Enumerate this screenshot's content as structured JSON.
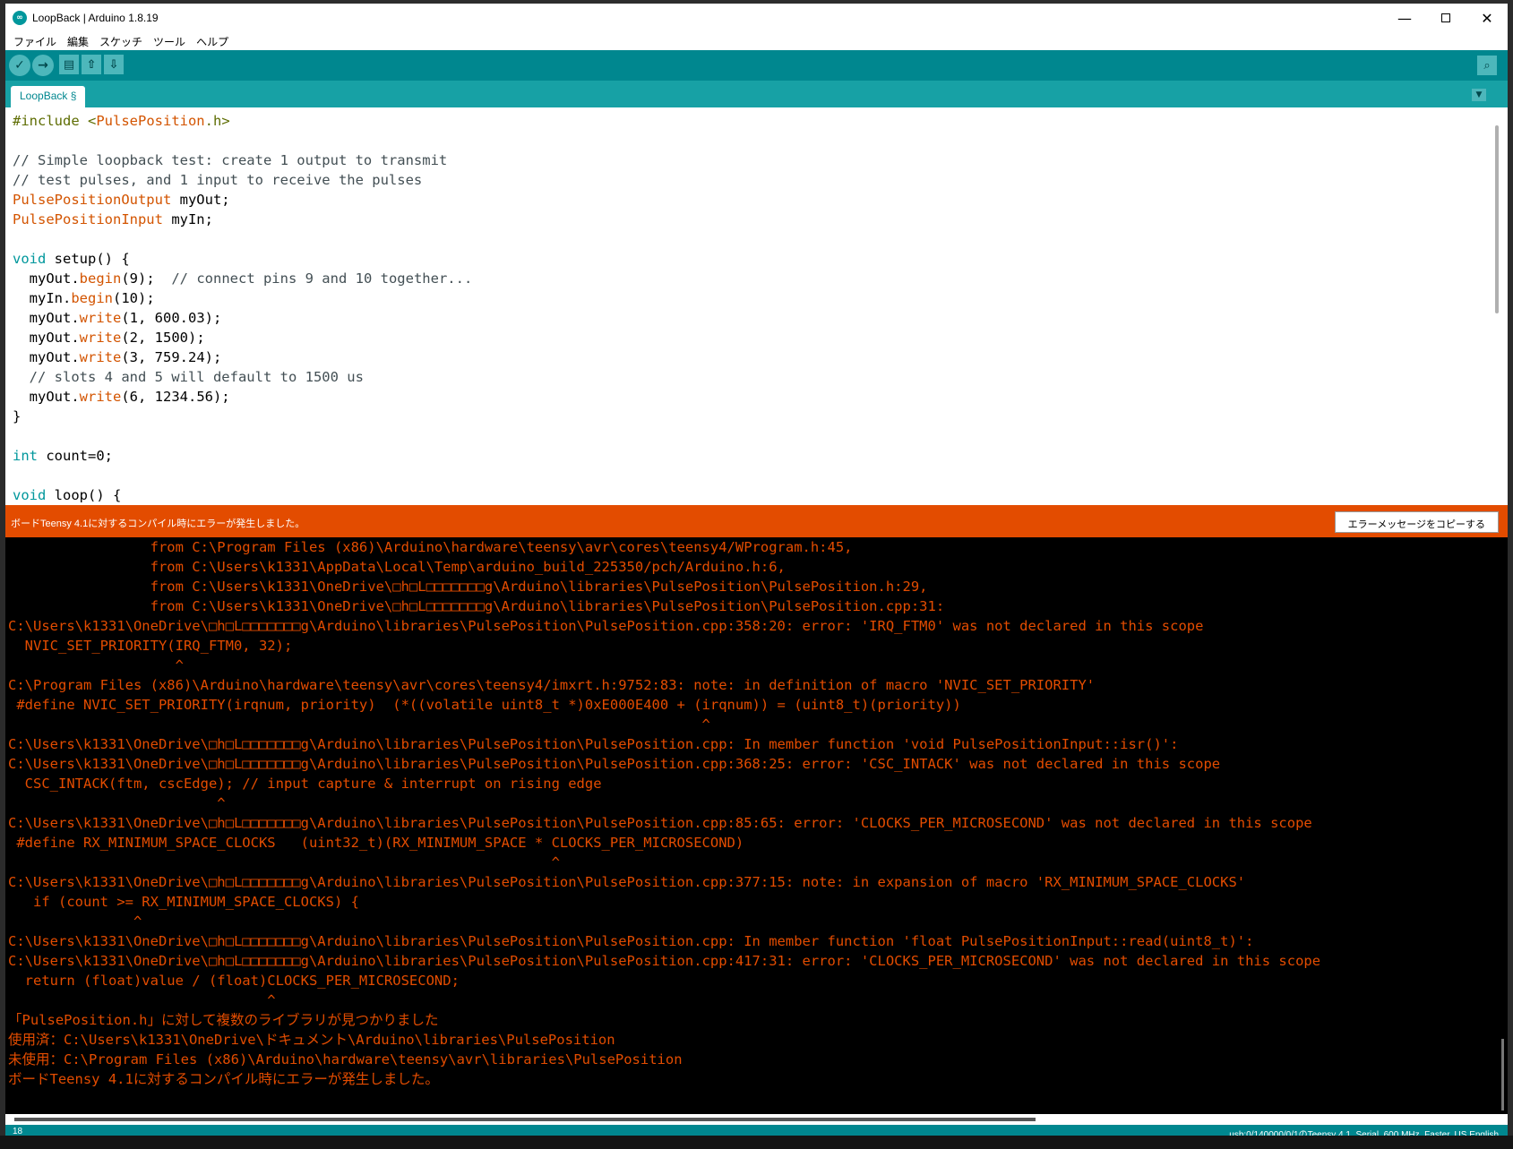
{
  "window": {
    "title": "LoopBack | Arduino 1.8.19",
    "minimize": "—",
    "close": "✕"
  },
  "menu": [
    "ファイル",
    "編集",
    "スケッチ",
    "ツール",
    "ヘルプ"
  ],
  "toolbar": {
    "verify_icon": "check-icon",
    "upload_icon": "arrow-right-icon",
    "new_icon": "new-file-icon",
    "open_icon": "open-arrow-up-icon",
    "save_icon": "save-arrow-down-icon",
    "serial_monitor_icon": "magnifier-icon"
  },
  "tab": {
    "label": "LoopBack §",
    "menu_icon": "triangle-down-icon"
  },
  "editor": {
    "lines": [
      [
        {
          "t": "#include <",
          "c": "pre"
        },
        {
          "t": "PulsePosition",
          "c": "func"
        },
        {
          "t": ".h>",
          "c": "pre"
        }
      ],
      [],
      [
        {
          "t": "// Simple loopback test: create 1 output to transmit",
          "c": "comment"
        }
      ],
      [
        {
          "t": "// test pulses, and 1 input to receive the pulses",
          "c": "comment"
        }
      ],
      [
        {
          "t": "PulsePositionOutput",
          "c": "func"
        },
        {
          "t": " myOut;",
          "c": ""
        }
      ],
      [
        {
          "t": "PulsePositionInput",
          "c": "func"
        },
        {
          "t": " myIn;",
          "c": ""
        }
      ],
      [],
      [
        {
          "t": "void",
          "c": "type"
        },
        {
          "t": " setup() {",
          "c": ""
        }
      ],
      [
        {
          "t": "  myOut.",
          "c": ""
        },
        {
          "t": "begin",
          "c": "func"
        },
        {
          "t": "(9);  ",
          "c": ""
        },
        {
          "t": "// connect pins 9 and 10 together...",
          "c": "comment"
        }
      ],
      [
        {
          "t": "  myIn.",
          "c": ""
        },
        {
          "t": "begin",
          "c": "func"
        },
        {
          "t": "(10);",
          "c": ""
        }
      ],
      [
        {
          "t": "  myOut.",
          "c": ""
        },
        {
          "t": "write",
          "c": "func"
        },
        {
          "t": "(1, 600.03);",
          "c": ""
        }
      ],
      [
        {
          "t": "  myOut.",
          "c": ""
        },
        {
          "t": "write",
          "c": "func"
        },
        {
          "t": "(2, 1500);",
          "c": ""
        }
      ],
      [
        {
          "t": "  myOut.",
          "c": ""
        },
        {
          "t": "write",
          "c": "func"
        },
        {
          "t": "(3, 759.24);",
          "c": ""
        }
      ],
      [
        {
          "t": "  // slots 4 and 5 will default to 1500 us",
          "c": "comment"
        }
      ],
      [
        {
          "t": "  myOut.",
          "c": ""
        },
        {
          "t": "write",
          "c": "func"
        },
        {
          "t": "(6, 1234.56);",
          "c": ""
        }
      ],
      [
        {
          "t": "}",
          "c": ""
        }
      ],
      [],
      [
        {
          "t": "int",
          "c": "type"
        },
        {
          "t": " count=0;",
          "c": ""
        }
      ],
      [],
      [
        {
          "t": "void",
          "c": "type"
        },
        {
          "t": " loop() {",
          "c": ""
        }
      ]
    ]
  },
  "status": {
    "message": "ボードTeensy 4.1に対するコンパイル時にエラーが発生しました。",
    "copy_button": "エラーメッセージをコピーする"
  },
  "console": {
    "lines": [
      "                 from C:\\Program Files (x86)\\Arduino\\hardware\\teensy\\avr\\cores\\teensy4/WProgram.h:45,",
      "                 from C:\\Users\\k1331\\AppData\\Local\\Temp\\arduino_build_225350/pch/Arduino.h:6,",
      "                 from C:\\Users\\k1331\\OneDrive\\□h□L□□□□□□□g\\Arduino\\libraries\\PulsePosition\\PulsePosition.h:29,",
      "                 from C:\\Users\\k1331\\OneDrive\\□h□L□□□□□□□g\\Arduino\\libraries\\PulsePosition\\PulsePosition.cpp:31:",
      "C:\\Users\\k1331\\OneDrive\\□h□L□□□□□□□g\\Arduino\\libraries\\PulsePosition\\PulsePosition.cpp:358:20: error: 'IRQ_FTM0' was not declared in this scope",
      "  NVIC_SET_PRIORITY(IRQ_FTM0, 32);",
      "                    ^",
      "C:\\Program Files (x86)\\Arduino\\hardware\\teensy\\avr\\cores\\teensy4/imxrt.h:9752:83: note: in definition of macro 'NVIC_SET_PRIORITY'",
      " #define NVIC_SET_PRIORITY(irqnum, priority)  (*((volatile uint8_t *)0xE000E400 + (irqnum)) = (uint8_t)(priority))",
      "                                                                                   ^",
      "C:\\Users\\k1331\\OneDrive\\□h□L□□□□□□□g\\Arduino\\libraries\\PulsePosition\\PulsePosition.cpp: In member function 'void PulsePositionInput::isr()':",
      "C:\\Users\\k1331\\OneDrive\\□h□L□□□□□□□g\\Arduino\\libraries\\PulsePosition\\PulsePosition.cpp:368:25: error: 'CSC_INTACK' was not declared in this scope",
      "  CSC_INTACK(ftm, cscEdge); // input capture & interrupt on rising edge",
      "                         ^",
      "C:\\Users\\k1331\\OneDrive\\□h□L□□□□□□□g\\Arduino\\libraries\\PulsePosition\\PulsePosition.cpp:85:65: error: 'CLOCKS_PER_MICROSECOND' was not declared in this scope",
      " #define RX_MINIMUM_SPACE_CLOCKS   (uint32_t)(RX_MINIMUM_SPACE * CLOCKS_PER_MICROSECOND)",
      "                                                                 ^",
      "C:\\Users\\k1331\\OneDrive\\□h□L□□□□□□□g\\Arduino\\libraries\\PulsePosition\\PulsePosition.cpp:377:15: note: in expansion of macro 'RX_MINIMUM_SPACE_CLOCKS'",
      "   if (count >= RX_MINIMUM_SPACE_CLOCKS) {",
      "               ^",
      "C:\\Users\\k1331\\OneDrive\\□h□L□□□□□□□g\\Arduino\\libraries\\PulsePosition\\PulsePosition.cpp: In member function 'float PulsePositionInput::read(uint8_t)':",
      "C:\\Users\\k1331\\OneDrive\\□h□L□□□□□□□g\\Arduino\\libraries\\PulsePosition\\PulsePosition.cpp:417:31: error: 'CLOCKS_PER_MICROSECOND' was not declared in this scope",
      "  return (float)value / (float)CLOCKS_PER_MICROSECOND;",
      "                               ^",
      "「PulsePosition.h」に対して複数のライブラリが見つかりました",
      "使用済：C:\\Users\\k1331\\OneDrive\\ドキュメント\\Arduino\\libraries\\PulsePosition",
      "未使用：C:\\Program Files (x86)\\Arduino\\hardware\\teensy\\avr\\libraries\\PulsePosition",
      "ボードTeensy 4.1に対するコンパイル時にエラーが発生しました。"
    ]
  },
  "footer": {
    "line_number": "18",
    "board_info": "usb:0/140000/0/1のTeensy 4.1, Serial, 600 MHz, Faster, US English"
  },
  "colors": {
    "teal_dark": "#00878f",
    "teal_tab": "#17a1a5",
    "error_orange": "#e34c00"
  }
}
